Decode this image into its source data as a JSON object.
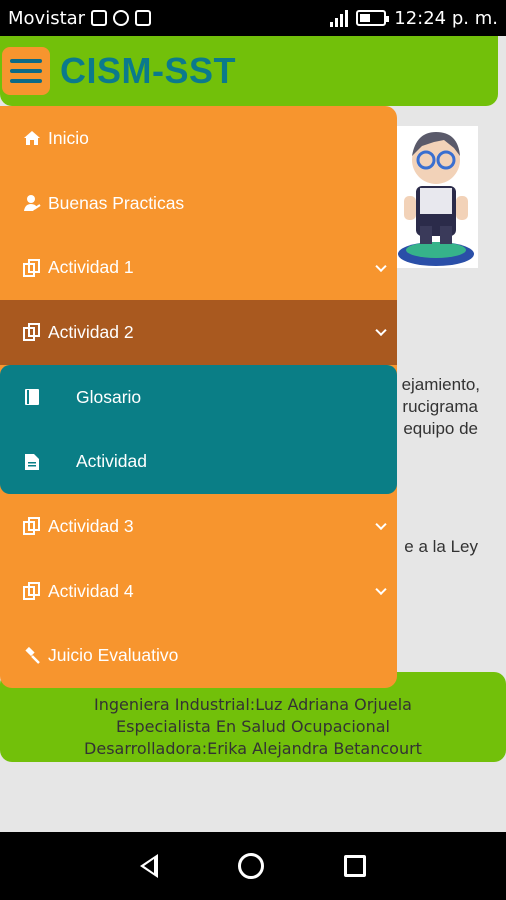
{
  "status_bar": {
    "carrier": "Movistar",
    "time": "12:24 p. m."
  },
  "header": {
    "title": "CISM-SST"
  },
  "drawer": {
    "items": [
      {
        "label": "Inicio",
        "icon": "home-icon"
      },
      {
        "label": "Buenas Practicas",
        "icon": "person-icon"
      },
      {
        "label": "Actividad 1",
        "icon": "copy-icon",
        "expandable": true
      },
      {
        "label": "Actividad 2",
        "icon": "copy-icon",
        "expandable": true,
        "expanded": true
      },
      {
        "label": "Actividad 3",
        "icon": "copy-icon",
        "expandable": true
      },
      {
        "label": "Actividad 4",
        "icon": "copy-icon",
        "expandable": true
      },
      {
        "label": "Juicio Evaluativo",
        "icon": "gavel-icon"
      }
    ],
    "submenu": [
      {
        "label": "Glosario",
        "icon": "book-icon"
      },
      {
        "label": "Actividad",
        "icon": "document-icon"
      }
    ]
  },
  "background_text": {
    "line1": "ejamiento,",
    "line2": "rucigrama",
    "line3": "equipo de",
    "line4": "e a la Ley"
  },
  "footer": {
    "line1": "Ingeniera Industrial:Luz Adriana Orjuela",
    "line2": "Especialista En Salud Ocupacional",
    "line3": "Desarrolladora:Erika Alejandra Betancourt"
  },
  "colors": {
    "header_green": "#72c00a",
    "drawer_orange": "#f7952e",
    "active_brown": "#a9591f",
    "submenu_teal": "#0a7e86",
    "title_teal": "#0b7a8c"
  }
}
